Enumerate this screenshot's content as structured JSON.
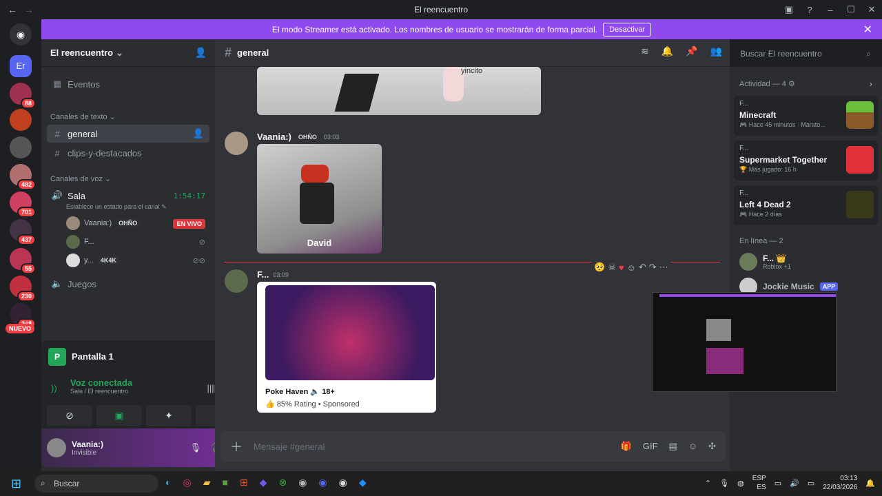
{
  "window": {
    "title": "El reencuentro",
    "back": "←",
    "forward": "→"
  },
  "banner": {
    "text": "El modo Streamer está activado. Los nombres de usuario se mostrarán de forma parcial.",
    "button": "Desactivar"
  },
  "server": {
    "name": "El reencuentro",
    "badges": [
      "88",
      "482",
      "701",
      "437",
      "55",
      "230",
      "248"
    ],
    "new_label": "NUEVO"
  },
  "sidebar": {
    "events": "Eventos",
    "text_category": "Canales de texto",
    "text_channels": [
      "general",
      "clips-y-destacados"
    ],
    "voice_category": "Canales de voz",
    "voice_channel": "Sala",
    "voice_timer": "1:54:17",
    "voice_status": "Establece un estado para el canal",
    "voice_users": [
      {
        "name": "Vaania:)",
        "tag": "OHÑO",
        "live": "EN VIVO"
      },
      {
        "name": "F..."
      },
      {
        "name": "y...",
        "tag": "4K4K"
      }
    ],
    "games_channel": "Juegos"
  },
  "panel": {
    "screen_name": "Pantalla 1",
    "voice_connected": "Voz conectada",
    "voice_location": "Sala / El reencuentro",
    "user_name": "Vaania:)",
    "user_status": "Invisible"
  },
  "chat": {
    "channel": "general",
    "messages": [
      {
        "author": "Vaania:)",
        "tag": "OHÑO",
        "time": "03:03",
        "caption": "David"
      },
      {
        "author": "F...",
        "time": "03:09",
        "ad_title": "Poke Haven",
        "ad_age": "18+",
        "ad_meta": "85% Rating • Sponsored",
        "overlay_text": "yincito"
      }
    ],
    "placeholder": "Mensaje #general"
  },
  "search": {
    "placeholder": "Buscar El reencuentro"
  },
  "activity": {
    "header": "Actividad — 4",
    "cards": [
      {
        "who": "F...",
        "game": "Minecraft",
        "sub": "Hace 45 minutos",
        "sub2": "Marato..."
      },
      {
        "who": "F...",
        "game": "Supermarket Together",
        "sub": "Más jugado: 16 h"
      },
      {
        "who": "F...",
        "game": "Left 4 Dead 2",
        "sub": "Hace 2 días"
      }
    ],
    "online_header": "En línea — 2",
    "members": [
      {
        "name": "F...",
        "sub": "Roblox +1"
      },
      {
        "name": "Jockie Music",
        "tag": "APP"
      }
    ]
  },
  "taskbar": {
    "search": "Buscar",
    "lang1": "ESP",
    "lang2": "ES",
    "time": "03:13",
    "date": "22/03/2026"
  },
  "colors": {
    "accent": "#5865f2",
    "banner": "#8f49ee",
    "online": "#23a55a",
    "live": "#da373c"
  }
}
